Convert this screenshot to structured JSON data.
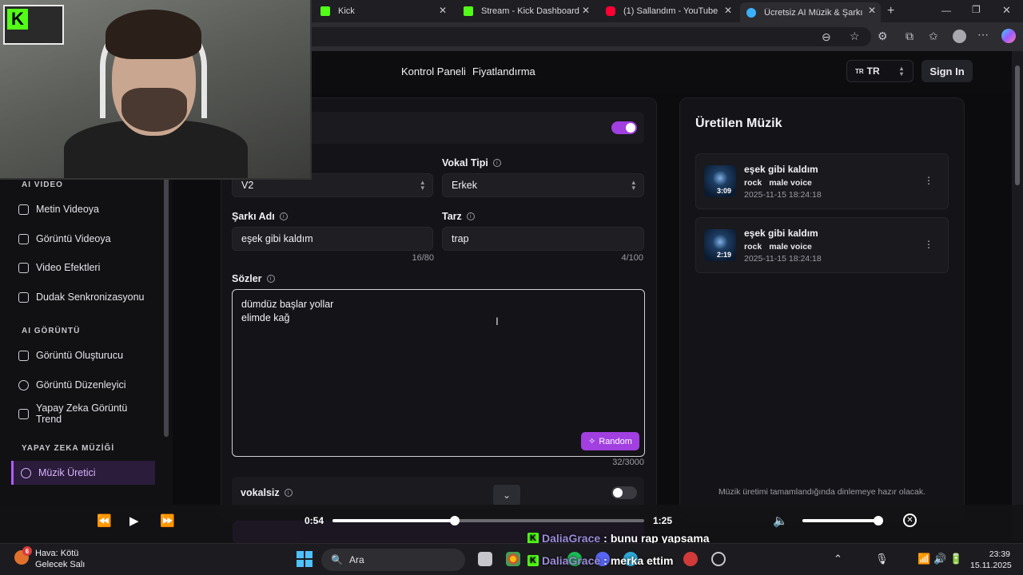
{
  "browser": {
    "tabs": [
      {
        "label": "Kick",
        "color": "#53fc18"
      },
      {
        "label": "Stream - Kick Dashboard",
        "color": "#53fc18"
      },
      {
        "label": "(1) Sallandım - YouTube",
        "color": "#ff0033"
      },
      {
        "label": "Ücretsiz AI Müzik & Şarkı Ür",
        "color": "#3bb0ff"
      }
    ],
    "new_tab_icon": "plus-icon"
  },
  "header": {
    "nav": [
      "Kontrol Paneli",
      "Fiyatlandırma"
    ],
    "language": {
      "flag": "TR",
      "value": "TR"
    },
    "sign_in": "Sign In"
  },
  "sidebar": {
    "sections": [
      {
        "title": "AI VIDEO",
        "items": [
          "Metin Videoya",
          "Görüntü Videoya",
          "Video Efektleri",
          "Dudak Senkronizasyonu"
        ]
      },
      {
        "title": "AI GÖRÜNTÜ",
        "items": [
          "Görüntü Oluşturucu",
          "Görüntü Düzenleyici",
          "Yapay Zeka Görüntü Trend"
        ]
      },
      {
        "title": "YAPAY ZEKA MÜZİĞİ",
        "items": [
          "Müzik Üretici"
        ]
      }
    ],
    "active_item": "Müzik Üretici"
  },
  "form": {
    "model_value": "V2",
    "vocal_type": {
      "label": "Vokal Tipi",
      "value": "Erkek"
    },
    "song_name": {
      "label": "Şarkı Adı",
      "value": "eşek gibi kaldım",
      "counter": "16/80"
    },
    "style": {
      "label": "Tarz",
      "value": "trap",
      "counter": "4/100"
    },
    "lyrics": {
      "label": "Sözler",
      "value": "dümdüz başlar yollar\nelimde kağ",
      "counter": "32/3000"
    },
    "random_button": "Random",
    "instrumental": {
      "label": "vokalsiz",
      "on": false
    },
    "top_toggle_on": true
  },
  "generated": {
    "title": "Üretilen Müzik",
    "tracks": [
      {
        "title": "eşek gibi kaldım",
        "duration": "3:09",
        "tags": [
          "rock",
          "male voice"
        ],
        "date": "2025-11-15 18:24:18"
      },
      {
        "title": "eşek gibi kaldım",
        "duration": "2:19",
        "tags": [
          "rock",
          "male voice"
        ],
        "date": "2025-11-15 18:24:18"
      }
    ],
    "note": "Müzik üretimi tamamlandığında dinlemeye hazır olacak."
  },
  "media": {
    "current": "0:54",
    "total": "1:25",
    "progress": 0.392,
    "volume": 0.95
  },
  "chat": [
    {
      "user": "DaliaGrace",
      "message": "bunu rap yapsama"
    },
    {
      "user": "DaliaGrace",
      "message": "merka ettim"
    }
  ],
  "taskbar": {
    "weather": {
      "line1": "Hava: Kötü",
      "line2": "Gelecek Salı",
      "badge": "6"
    },
    "search": "Ara",
    "time": "23:39",
    "date": "15.11.2025"
  },
  "colors": {
    "accent": "#a13fe0",
    "kick": "#53fc18"
  }
}
